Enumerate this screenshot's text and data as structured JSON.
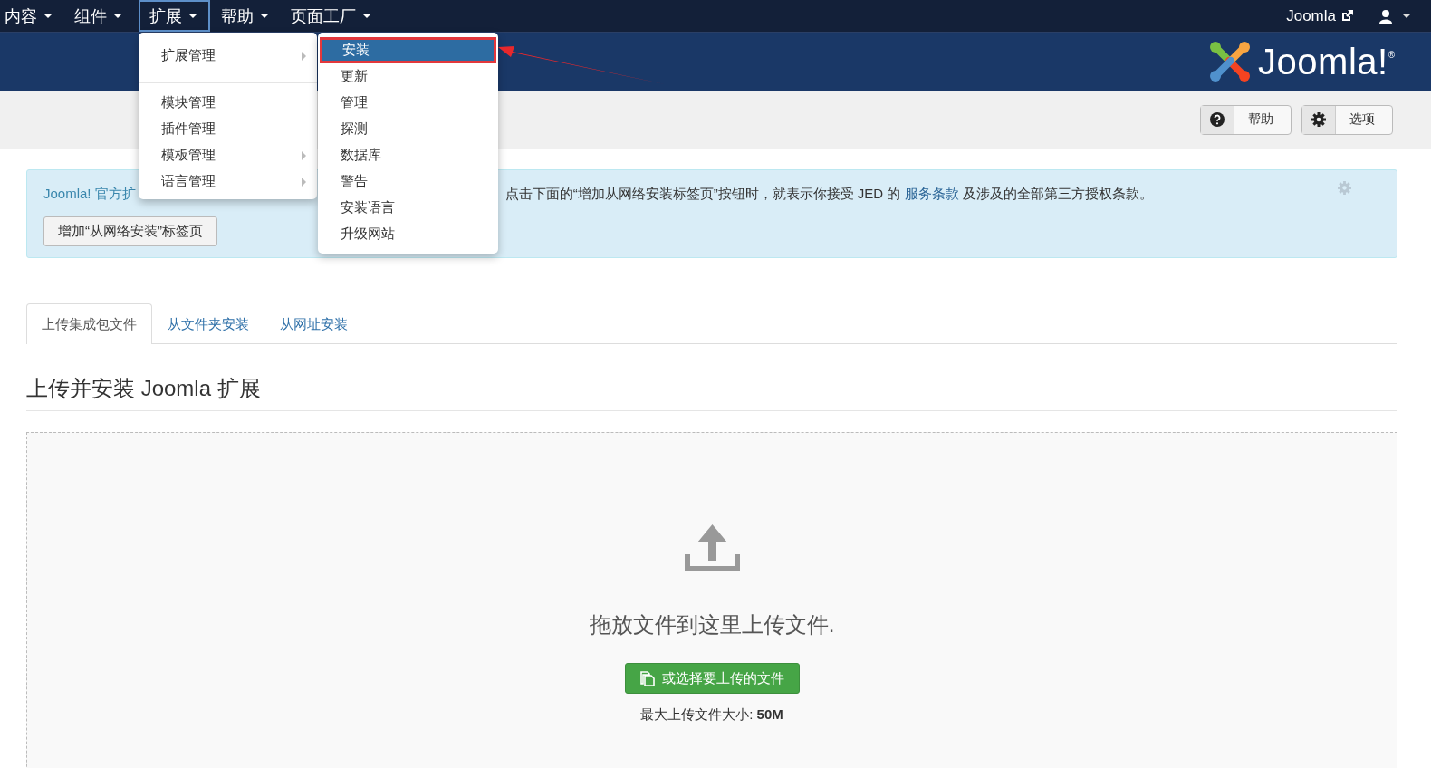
{
  "navbar": {
    "menus": [
      {
        "label": "内容",
        "selected": false
      },
      {
        "label": "组件",
        "selected": false
      },
      {
        "label": "扩展",
        "selected": true
      },
      {
        "label": "帮助",
        "selected": false
      },
      {
        "label": "页面工厂",
        "selected": false
      }
    ],
    "site_link": "Joomla"
  },
  "dropdown": {
    "items": [
      {
        "label": "扩展管理",
        "has_submenu": true,
        "divider_after": true
      },
      {
        "label": "模块管理",
        "has_submenu": false,
        "divider_after": false
      },
      {
        "label": "插件管理",
        "has_submenu": false,
        "divider_after": false
      },
      {
        "label": "模板管理",
        "has_submenu": true,
        "divider_after": false
      },
      {
        "label": "语言管理",
        "has_submenu": true,
        "divider_after": false
      }
    ],
    "submenu": [
      {
        "label": "安装",
        "selected": true,
        "callout": true
      },
      {
        "label": "更新",
        "selected": false,
        "callout": false
      },
      {
        "label": "管理",
        "selected": false,
        "callout": false
      },
      {
        "label": "探测",
        "selected": false,
        "callout": false
      },
      {
        "label": "数据库",
        "selected": false,
        "callout": false
      },
      {
        "label": "警告",
        "selected": false,
        "callout": false
      },
      {
        "label": "安装语言",
        "selected": false,
        "callout": false
      },
      {
        "label": "升级网站",
        "selected": false,
        "callout": false
      }
    ]
  },
  "header": {
    "logo_text": "Joomla!",
    "logo_mark": "®"
  },
  "toolbar": {
    "buttons": [
      {
        "label": "帮助",
        "kind": "help"
      },
      {
        "label": "选项",
        "kind": "settings"
      }
    ]
  },
  "alert": {
    "text_start": "Joomla! 官方扩",
    "text_end": "点击下面的“增加从网络安装标签页”按钮时，就表示你接受 JED 的 ",
    "link": "服务条款",
    "text_after": " 及涉及的全部第三方授权条款。",
    "button": "增加“从网络安装”标签页"
  },
  "tabs": [
    {
      "label": "上传集成包文件",
      "selected": true
    },
    {
      "label": "从文件夹安装",
      "selected": false
    },
    {
      "label": "从网址安装",
      "selected": false
    }
  ],
  "heading": "上传并安装 Joomla 扩展",
  "dropzone": {
    "message": "拖放文件到这里上传文件.",
    "button": "或选择要上传的文件",
    "max_size": "最大上传文件大小: **50M**"
  }
}
